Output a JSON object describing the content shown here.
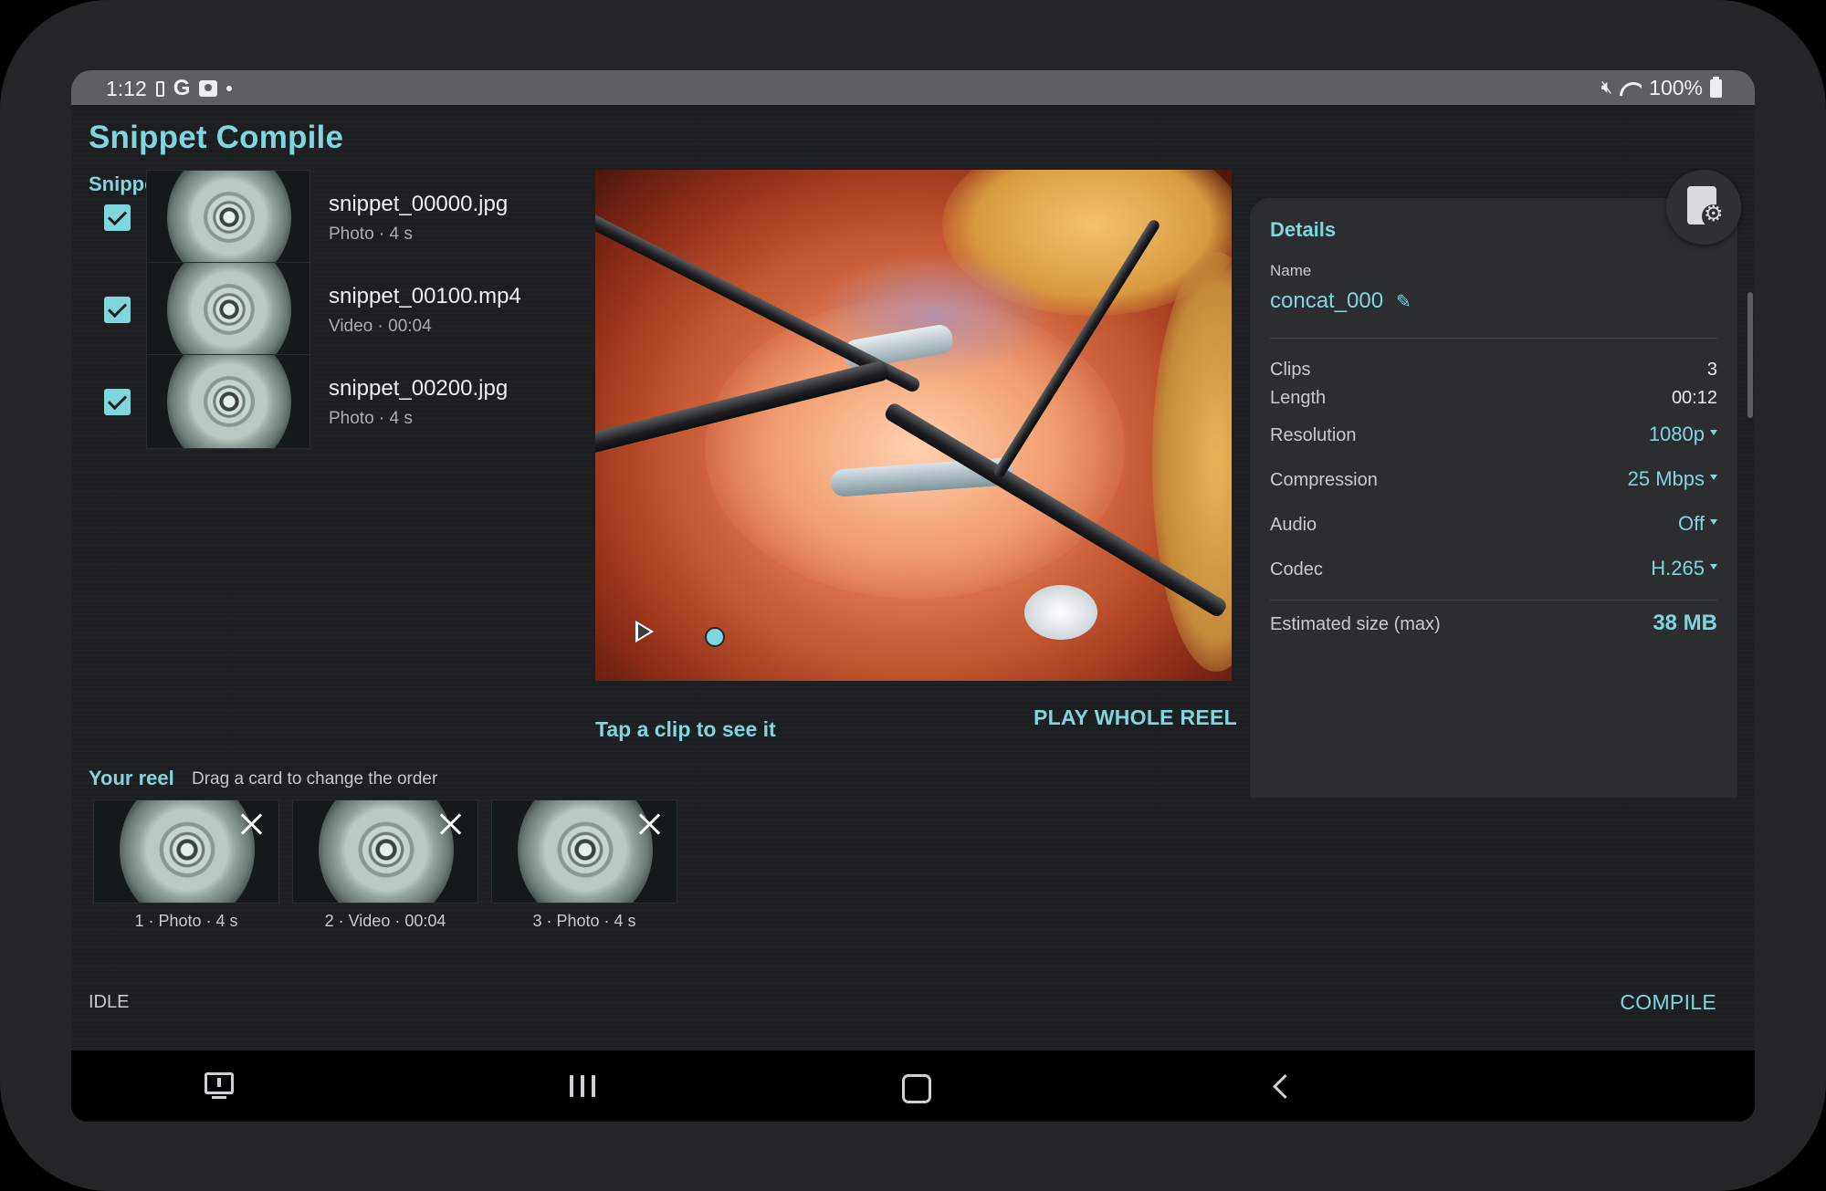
{
  "status_bar": {
    "time": "1:12",
    "battery_percent": "100%",
    "icons": [
      "battery-saver-icon",
      "google-icon",
      "photo-icon",
      "dot-icon",
      "mute-icon",
      "wifi-icon",
      "battery-icon"
    ]
  },
  "app": {
    "title": "Snippet Compile"
  },
  "snippets": {
    "title": "Snippets and photos",
    "items": [
      {
        "name": "snippet_00000.jpg",
        "meta": "Photo · 4 s",
        "checked": true
      },
      {
        "name": "snippet_00100.mp4",
        "meta": "Video · 00:04",
        "checked": true
      },
      {
        "name": "snippet_00200.jpg",
        "meta": "Photo · 4 s",
        "checked": true
      }
    ]
  },
  "preview": {
    "hint": "Tap a clip to see it",
    "play_whole_reel": "PLAY WHOLE REEL"
  },
  "details": {
    "title": "Details",
    "name_label": "Name",
    "name_value": "concat_000",
    "clips_label": "Clips",
    "clips_value": "3",
    "length_label": "Length",
    "length_value": "00:12",
    "resolution_label": "Resolution",
    "resolution_value": "1080p",
    "compression_label": "Compression",
    "compression_value": "25 Mbps",
    "audio_label": "Audio",
    "audio_value": "Off",
    "codec_label": "Codec",
    "codec_value": "H.265",
    "size_label": "Estimated size (max)",
    "size_value": "38 MB"
  },
  "reel": {
    "title": "Your reel",
    "hint": "Drag a card to change the order",
    "cards": [
      {
        "caption": "1 · Photo · 4 s"
      },
      {
        "caption": "2 · Video · 00:04"
      },
      {
        "caption": "3 · Photo · 4 s"
      }
    ]
  },
  "footer": {
    "status": "IDLE",
    "compile": "COMPILE"
  },
  "colors": {
    "accent": "#7fd6dc",
    "background": "#1c1e21",
    "panel": "#2b2d30"
  }
}
